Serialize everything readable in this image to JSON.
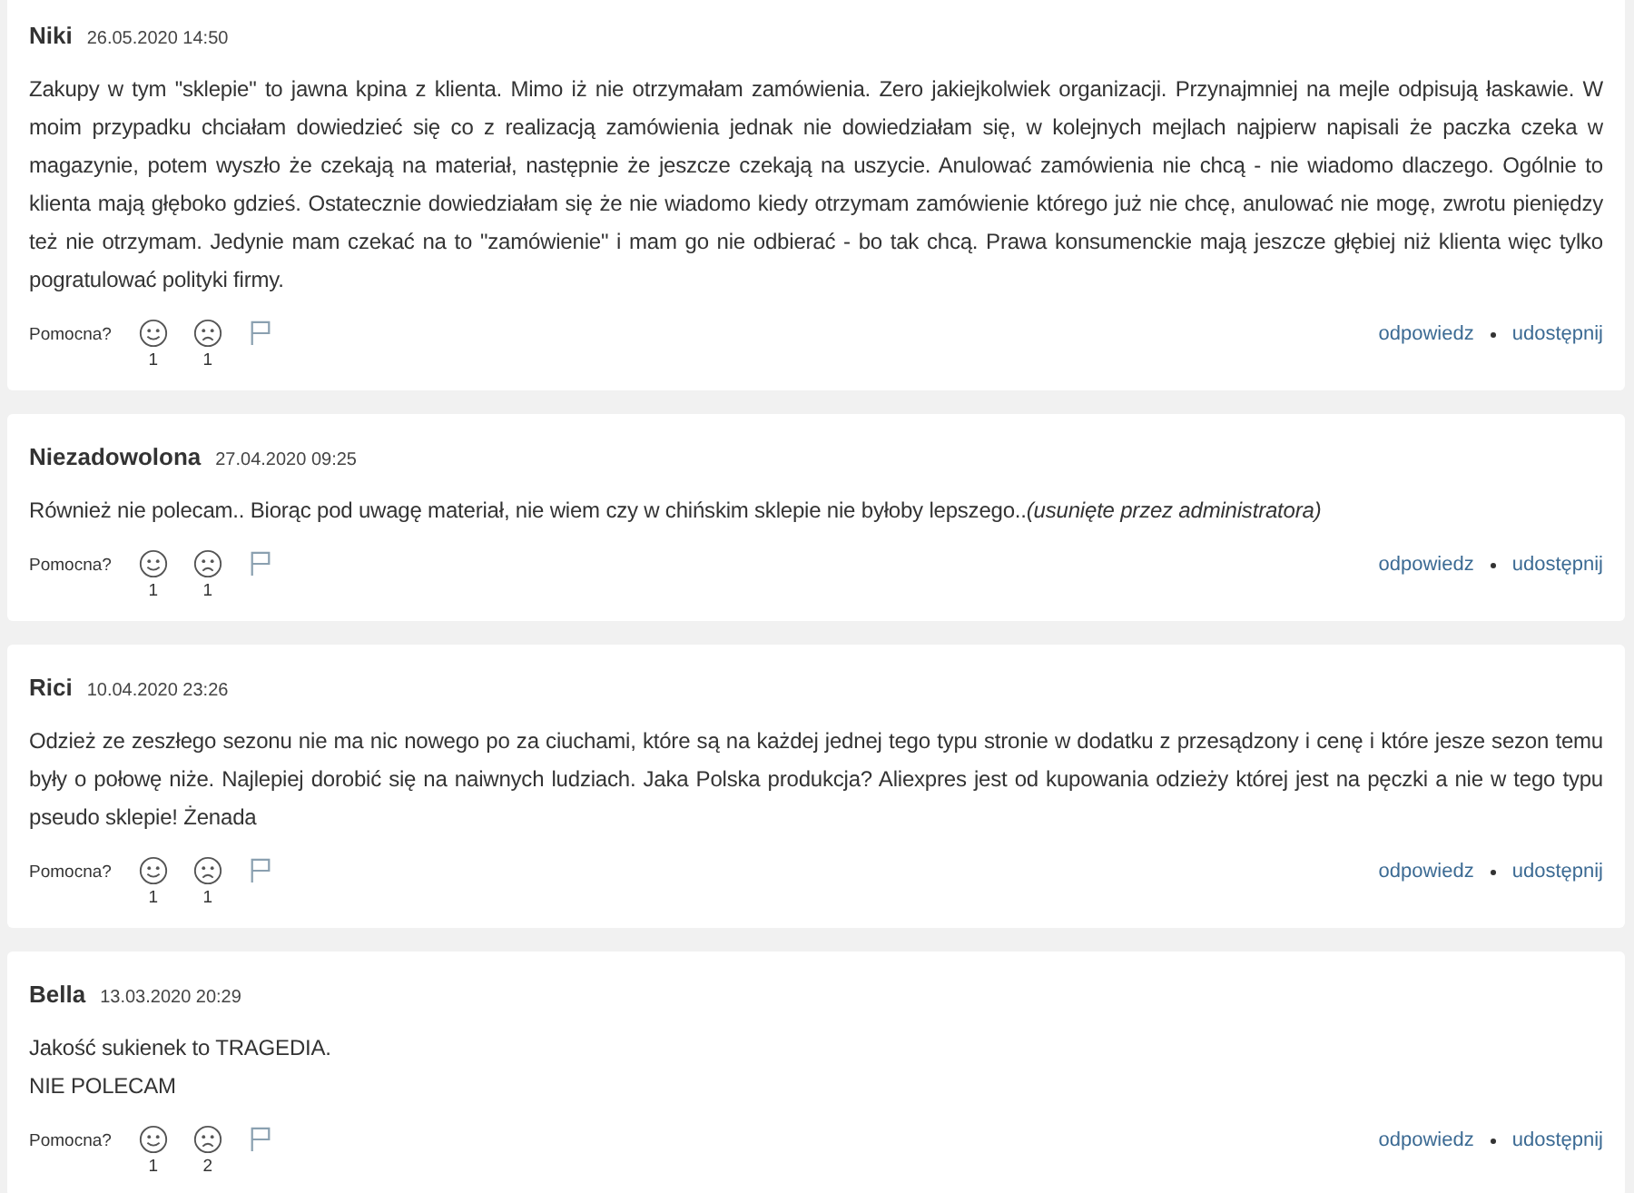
{
  "reviews": [
    {
      "author": "Niki",
      "date": "26.05.2020 14:50",
      "text": "Zakupy w tym \"sklepie\" to jawna kpina z klienta. Mimo iż nie otrzymałam zamówienia. Zero jakiejkolwiek organizacji. Przynajmniej na mejle odpisują łaskawie. W moim przypadku chciałam dowiedzieć się co z realizacją zamówienia jednak nie dowiedziałam się, w kolejnych mejlach najpierw napisali że paczka czeka w magazynie, potem wyszło że czekają na materiał, następnie że jeszcze czekają na uszycie. Anulować zamówienia nie chcą - nie wiadomo dlaczego. Ogólnie to klienta mają głęboko gdzieś. Ostatecznie dowiedziałam się że nie wiadomo kiedy otrzymam zamówienie którego już nie chcę, anulować nie mogę, zwrotu pieniędzy też nie otrzymam. Jedynie mam czekać na to \"zamówienie\" i mam go nie odbierać - bo tak chcą. Prawa konsumenckie mają jeszcze głębiej niż klienta więc tylko pogratulować polityki firmy.",
      "helpful_label": "Pomocna?",
      "likes": "1",
      "dislikes": "1",
      "reply": "odpowiedz",
      "share": "udostępnij"
    },
    {
      "author": "Niezadowolona",
      "date": "27.04.2020 09:25",
      "text": "Również nie polecam.. Biorąc pod uwagę materiał, nie wiem czy w chińskim sklepie nie byłoby lepszego..*(usunięte przez administratora)*",
      "helpful_label": "Pomocna?",
      "likes": "1",
      "dislikes": "1",
      "reply": "odpowiedz",
      "share": "udostępnij"
    },
    {
      "author": "Rici",
      "date": "10.04.2020 23:26",
      "text": "Odzież ze zeszłego sezonu nie ma nic nowego po za ciuchami, które są na każdej jednej tego typu stronie w dodatku z przesądzony i cenę i które jesze sezon temu były o połowę niże. Najlepiej dorobić się na naiwnych ludziach. Jaka Polska produkcja? Aliexpres jest od kupowania odzieży której jest na pęczki a nie w tego typu pseudo sklepie! Żenada",
      "helpful_label": "Pomocna?",
      "likes": "1",
      "dislikes": "1",
      "reply": "odpowiedz",
      "share": "udostępnij"
    },
    {
      "author": "Bella",
      "date": "13.03.2020 20:29",
      "text": "Jakość sukienek to TRAGEDIA.\nNIE POLECAM",
      "helpful_label": "Pomocna?",
      "likes": "1",
      "dislikes": "2",
      "reply": "odpowiedz",
      "share": "udostępnij"
    }
  ]
}
